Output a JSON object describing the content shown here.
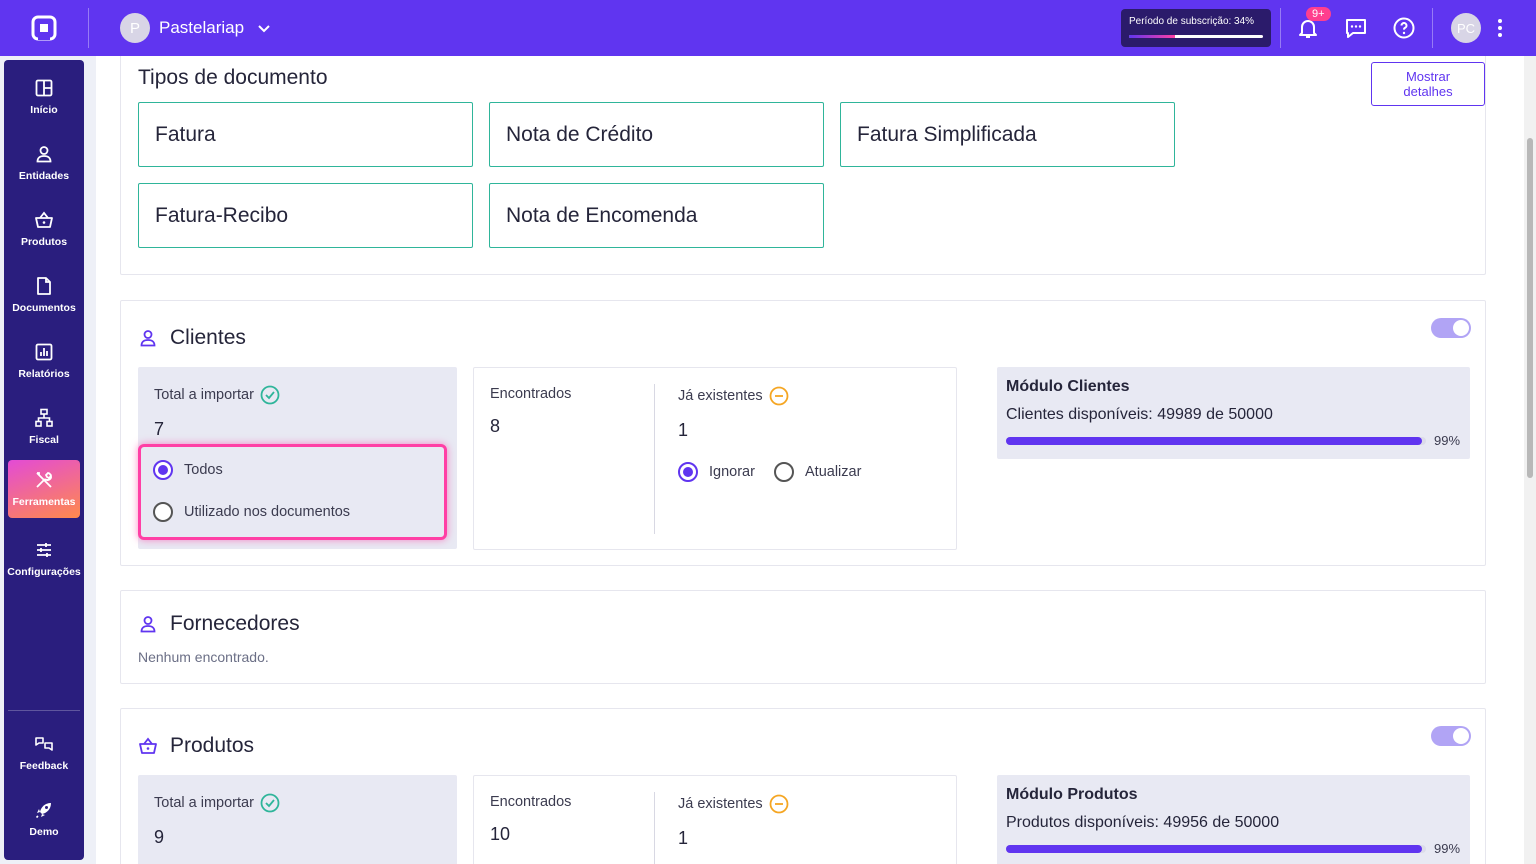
{
  "topbar": {
    "company_initial": "P",
    "company_name": "Pastelariap",
    "subscription_label": "Período de subscrição: 34%",
    "subscription_progress": 0.34,
    "notification_badge": "9+",
    "user_initials": "PC"
  },
  "sidebar": {
    "items": [
      {
        "label": "Início",
        "icon": "grid-icon"
      },
      {
        "label": "Entidades",
        "icon": "user-icon"
      },
      {
        "label": "Produtos",
        "icon": "basket-icon"
      },
      {
        "label": "Documentos",
        "icon": "document-icon"
      },
      {
        "label": "Relatórios",
        "icon": "chart-icon"
      },
      {
        "label": "Fiscal",
        "icon": "hierarchy-icon"
      },
      {
        "label": "Ferramentas",
        "icon": "tools-icon"
      },
      {
        "label": "Configurações",
        "icon": "sliders-icon"
      }
    ],
    "bottom": [
      {
        "label": "Feedback",
        "icon": "feedback-icon"
      },
      {
        "label": "Demo",
        "icon": "rocket-icon"
      }
    ],
    "active": "Ferramentas"
  },
  "document_types": {
    "title": "Tipos de documento",
    "details_button": "Mostrar detalhes",
    "items": [
      "Fatura",
      "Nota de Crédito",
      "Fatura Simplificada",
      "Fatura-Recibo",
      "Nota de Encomenda"
    ]
  },
  "clientes": {
    "title": "Clientes",
    "total_label": "Total a importar",
    "total_value": "7",
    "option_all": "Todos",
    "option_used": "Utilizado nos documentos",
    "found_label": "Encontrados",
    "found_value": "8",
    "existing_label": "Já existentes",
    "existing_value": "1",
    "ignore_label": "Ignorar",
    "update_label": "Atualizar",
    "module_title": "Módulo Clientes",
    "module_text": "Clientes disponíveis: 49989 de 50000",
    "module_progress": 0.99,
    "module_pct": "99%"
  },
  "fornecedores": {
    "title": "Fornecedores",
    "empty": "Nenhum encontrado."
  },
  "produtos": {
    "title": "Produtos",
    "total_label": "Total a importar",
    "total_value": "9",
    "found_label": "Encontrados",
    "found_value": "10",
    "existing_label": "Já existentes",
    "existing_value": "1",
    "module_title": "Módulo Produtos",
    "module_text": "Produtos disponíveis: 49956 de 50000",
    "module_progress": 0.99,
    "module_pct": "99%"
  },
  "colors": {
    "brand": "#6035f0",
    "sidebar": "#2a1e7e",
    "accent_green": "#2fb59a",
    "highlight": "#ff3fa5",
    "warning": "#f5a623"
  }
}
